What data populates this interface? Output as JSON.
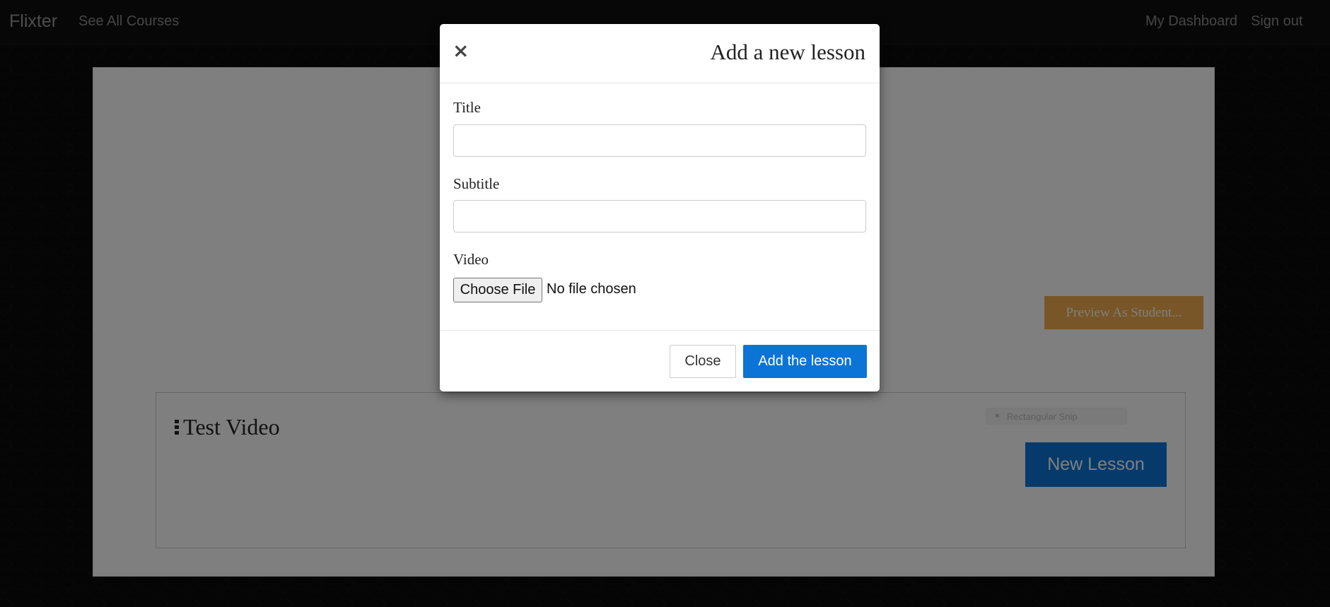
{
  "navbar": {
    "brand": "Flixter",
    "see_all_courses": "See All Courses",
    "my_dashboard": "My Dashboard",
    "sign_out": "Sign out"
  },
  "course": {
    "preview_button": "Preview As Student...",
    "section_title": "Test Video",
    "new_lesson_button": "New Lesson",
    "ghost_input_text": "Rectangular Snip"
  },
  "modal": {
    "close_icon": "×",
    "title": "Add a new lesson",
    "title_label": "Title",
    "title_value": "",
    "subtitle_label": "Subtitle",
    "subtitle_value": "",
    "video_label": "Video",
    "choose_file_button": "Choose File",
    "file_status": "No file chosen",
    "close_button": "Close",
    "submit_button": "Add the lesson"
  },
  "colors": {
    "primary": "#0b74d6",
    "warning": "#f0ad4e",
    "navbar_bg": "#0e0e0e"
  }
}
